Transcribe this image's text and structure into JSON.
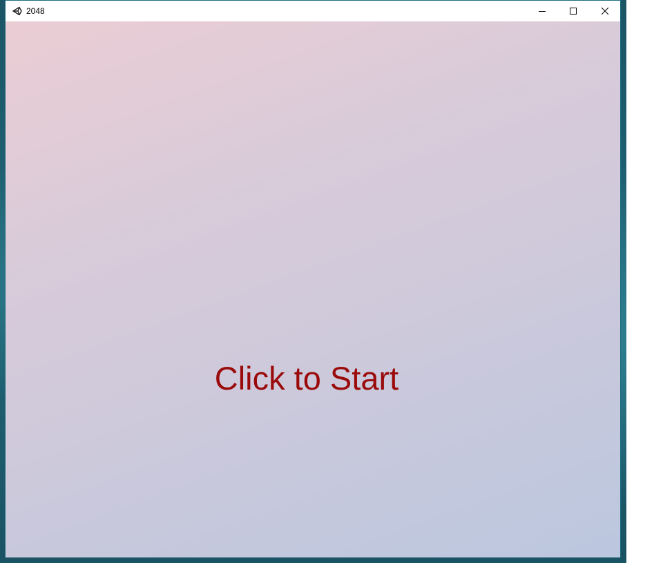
{
  "window": {
    "title": "2048",
    "app_icon": "unity-icon",
    "controls": {
      "minimize": "minimize-icon",
      "maximize": "maximize-icon",
      "close": "close-icon"
    }
  },
  "game": {
    "start_prompt": "Click to Start",
    "prompt_color": "#9a0a0a",
    "background_colors": [
      "#ebcdd4",
      "#bbc7df"
    ]
  }
}
